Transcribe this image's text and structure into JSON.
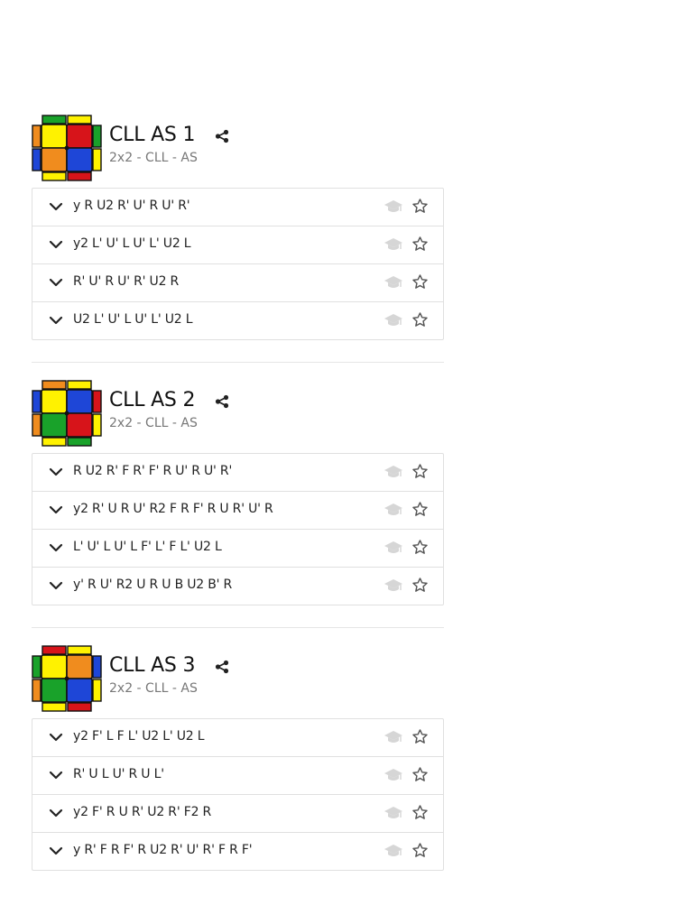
{
  "cases": [
    {
      "title": "CLL AS 1",
      "subtitle": "2x2 - CLL - AS",
      "cube_colors": {
        "top_strips": [
          "green",
          "yellow"
        ],
        "left_strips": [
          "orange",
          "blue"
        ],
        "right_strips": [
          "green",
          "yellow"
        ],
        "bottom_strips": [
          "yellow",
          "red"
        ],
        "face": [
          "yellow",
          "red",
          "orange",
          "blue"
        ]
      },
      "algs": [
        "y R U2 R' U' R U' R'",
        "y2 L' U' L U' L' U2 L",
        "R' U' R U' R' U2 R",
        "U2 L' U' L U' L' U2 L"
      ]
    },
    {
      "title": "CLL AS 2",
      "subtitle": "2x2 - CLL - AS",
      "cube_colors": {
        "top_strips": [
          "orange",
          "yellow"
        ],
        "left_strips": [
          "blue",
          "orange"
        ],
        "right_strips": [
          "red",
          "yellow"
        ],
        "bottom_strips": [
          "yellow",
          "green"
        ],
        "face": [
          "yellow",
          "blue",
          "green",
          "red"
        ]
      },
      "algs": [
        "R U2 R' F R' F' R U' R U' R'",
        "y2 R' U R U' R2 F R F' R U R' U' R",
        "L' U' L U' L F' L' F L' U2 L",
        "y' R U' R2 U R U B U2 B' R"
      ]
    },
    {
      "title": "CLL AS 3",
      "subtitle": "2x2 - CLL - AS",
      "cube_colors": {
        "top_strips": [
          "red",
          "yellow"
        ],
        "left_strips": [
          "green",
          "orange"
        ],
        "right_strips": [
          "blue",
          "yellow"
        ],
        "bottom_strips": [
          "yellow",
          "red"
        ],
        "face": [
          "yellow",
          "orange",
          "green",
          "blue"
        ]
      },
      "algs": [
        "y2 F' L F L' U2 L' U2 L",
        "R' U L U' R U L'",
        "y2 F' R U R' U2 R' F2 R",
        "y R' F R F' R U2 R' U' R' F R F'"
      ]
    }
  ],
  "colors": {
    "yellow": "#FFF200",
    "red": "#D7141A",
    "orange": "#F08C1E",
    "blue": "#1E46D7",
    "green": "#19A22A",
    "icon_muted": "#d6d6d6",
    "star": "#555555",
    "border": "#e0e0e0"
  },
  "icons": {
    "share": "share-icon",
    "expand": "chevron-down-icon",
    "learn": "graduation-cap-icon",
    "favorite": "star-icon"
  }
}
